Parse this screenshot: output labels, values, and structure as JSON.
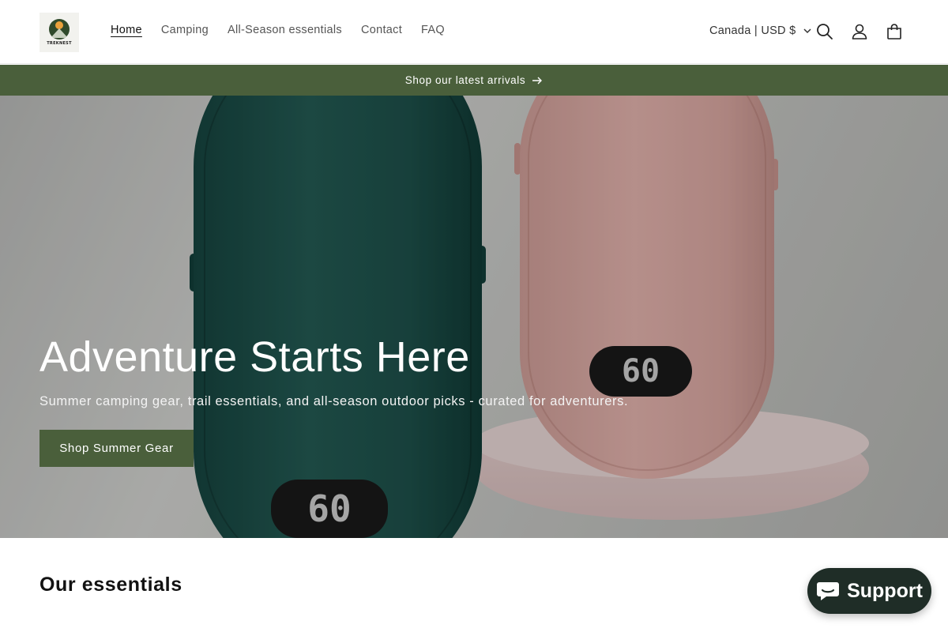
{
  "header": {
    "logo_text": "TREKNEST",
    "nav": [
      {
        "label": "Home",
        "active": true
      },
      {
        "label": "Camping",
        "active": false
      },
      {
        "label": "All-Season essentials",
        "active": false
      },
      {
        "label": "Contact",
        "active": false
      },
      {
        "label": "FAQ",
        "active": false
      }
    ],
    "locale_label": "Canada | USD $",
    "icons": [
      "search-icon",
      "account-icon",
      "cart-icon",
      "chevron-down-icon"
    ]
  },
  "announcement": {
    "text": "Shop our latest arrivals",
    "icon": "arrow-right-icon"
  },
  "hero": {
    "title": "Adventure Starts Here",
    "subtitle": "Summer camping gear, trail essentials, and all-season outdoor picks - curated for adventurers.",
    "button_label": "Shop Summer Gear",
    "device_display_pink": "60",
    "device_display_green": "60"
  },
  "section": {
    "title": "Our essentials"
  },
  "chat": {
    "label": "Support",
    "icon": "chat-bubble-icon"
  },
  "colors": {
    "brand_green": "#4a5f3b",
    "chat_bg": "#1f2d27",
    "text": "#121212"
  }
}
